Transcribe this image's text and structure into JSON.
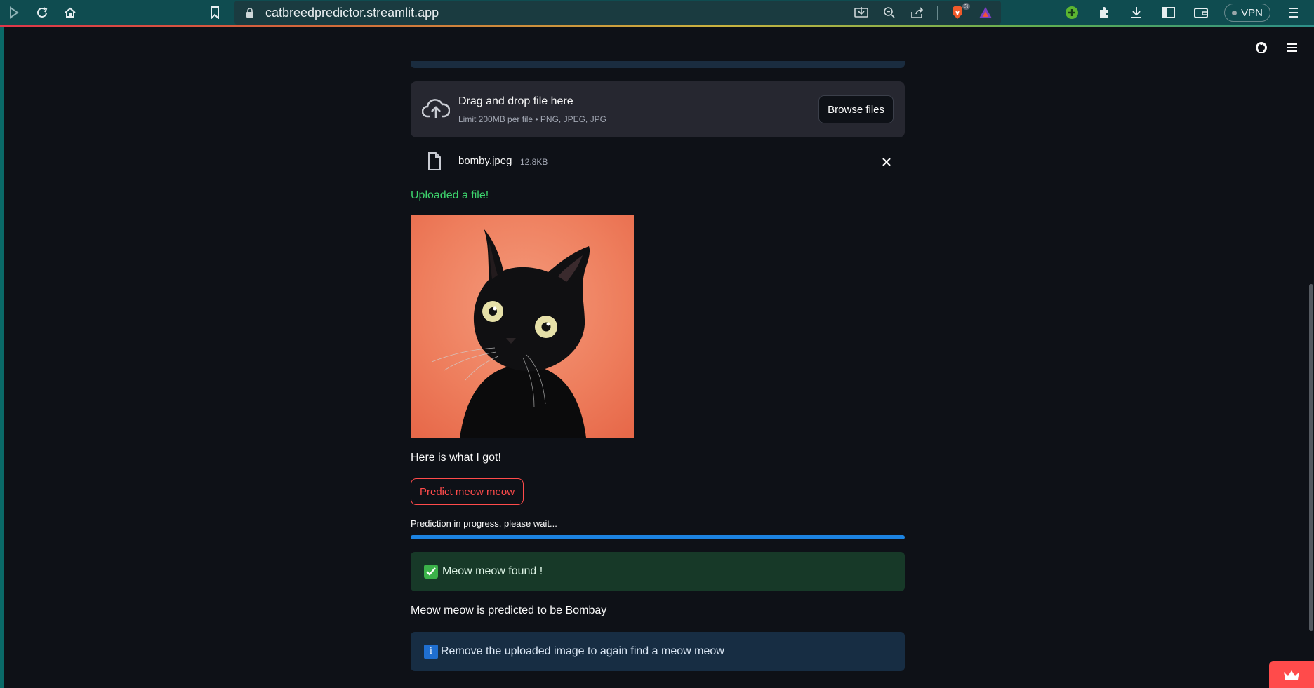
{
  "browser": {
    "url": "catbreedpredictor.streamlit.app",
    "brave_count": "3",
    "vpn_label": "VPN"
  },
  "uploader": {
    "title": "Drag and drop file here",
    "subtitle": "Limit 200MB per file • PNG, JPEG, JPG",
    "browse_label": "Browse files"
  },
  "file": {
    "name": "bomby.jpeg",
    "size": "12.8KB"
  },
  "status": {
    "uploaded": "Uploaded a file!",
    "caption": "Here is what I got!",
    "predict_label": "Predict meow meow",
    "progress_label": "Prediction in progress, please wait...",
    "progress": 1.0,
    "success_text": "Meow meow found !",
    "result_text": "Meow meow is predicted to be Bombay",
    "info_text": "Remove the uploaded image to again find a meow meow"
  },
  "colors": {
    "accent": "#ff4b4b",
    "success": "#3dd56d",
    "progress": "#1c83e1"
  }
}
